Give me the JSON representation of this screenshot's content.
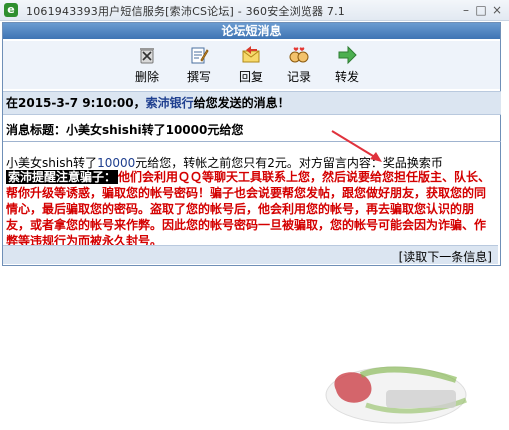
{
  "window": {
    "title": "1061943393用户短信服务[索沛CS论坛] - 360安全浏览器 7.1",
    "minimize": "–",
    "maximize": "□",
    "close": "×"
  },
  "header": {
    "title": "论坛短消息"
  },
  "toolbar": {
    "items": [
      {
        "label": "删除",
        "icon": "delete-icon"
      },
      {
        "label": "撰写",
        "icon": "compose-icon"
      },
      {
        "label": "回复",
        "icon": "reply-icon"
      },
      {
        "label": "记录",
        "icon": "record-icon"
      },
      {
        "label": "转发",
        "icon": "forward-icon"
      }
    ]
  },
  "message": {
    "from_prefix": "在2015-3-7 9:10:00，",
    "sender": "索沛银行",
    "from_suffix": "给您发送的消息！",
    "subject": "消息标题：小美女shishi转了10000元给您",
    "body_part1": "小美女shish转了",
    "body_amount": "10000",
    "body_part2": "元给您，转帐之前您只有2元。对方留言内容：奖品换索币",
    "warning_tag": "索沛提醒注意骗子：",
    "warning_text": "他们会利用ＱＱ等聊天工具联系上您，然后说要给您担任版主、队长、帮你升级等诱惑，骗取您的帐号密码！骗子也会说要帮您发帖，跟您做好朋友，获取您的同情心，最后骗取您的密码。盗取了您的帐号后，他会利用您的帐号，再去骗取您认识的朋友，或者拿您的帐号来作弊。因此您的帐号密码一旦被骗取，您的帐号可能会因为诈骗、作弊等违规行为而被永久封号。",
    "next_link": "[读取下一条信息]"
  },
  "colors": {
    "header_bg": "#4a80c0",
    "warning_red": "#d40000",
    "annotation_arrow": "#e0323c"
  }
}
